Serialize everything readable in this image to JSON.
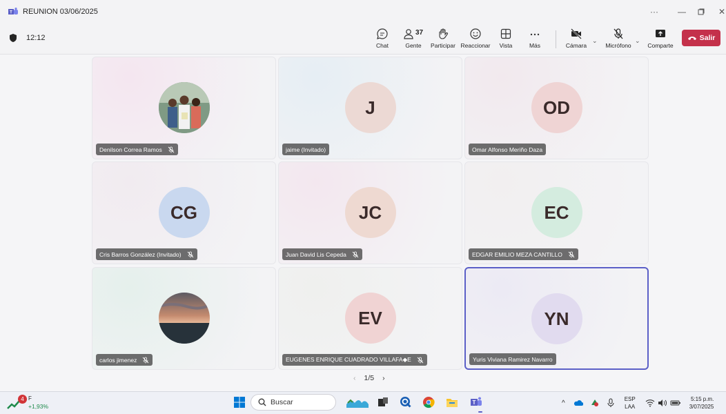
{
  "window": {
    "title": "REUNION 03/06/2025"
  },
  "meeting": {
    "elapsed": "12:12",
    "people_count": "37"
  },
  "toolbar": {
    "chat": "Chat",
    "people": "Gente",
    "raise": "Participar",
    "react": "Reaccionar",
    "view": "Vista",
    "more": "Más",
    "camera": "Cámara",
    "mic": "Micrófono",
    "share": "Comparte",
    "leave": "Salir"
  },
  "tiles": [
    {
      "name": "Denilson Correa Ramos",
      "initials": "",
      "muted": true,
      "avatar_type": "photo-people",
      "bg": "#f4e6f0"
    },
    {
      "name": "jaime (Invitado)",
      "initials": "J",
      "muted": false,
      "avatar_bg": "#ecd9d4",
      "bg": "#e6eef4"
    },
    {
      "name": "Omar Alfonso Meriño Daza",
      "initials": "OD",
      "muted": false,
      "avatar_bg": "#efd4d4",
      "bg": "#f2e9ee"
    },
    {
      "name": "Cris Barros González (Invitado)",
      "initials": "CG",
      "muted": true,
      "avatar_bg": "#c9d8ef",
      "bg": "#f1ebf0"
    },
    {
      "name": "Juan David Lis Cepeda",
      "initials": "JC",
      "muted": true,
      "avatar_bg": "#eed9d1",
      "bg": "#f3e7ef"
    },
    {
      "name": "EDGAR EMILIO MEZA CANTILLO",
      "initials": "EC",
      "muted": true,
      "avatar_bg": "#d4ecdf",
      "bg": "#f2eff0"
    },
    {
      "name": "carlos jimenez",
      "initials": "",
      "muted": true,
      "avatar_type": "photo-sunset",
      "bg": "#e5f0ec"
    },
    {
      "name": "EUGENES ENRIQUE CUADRADO VILLAFA◆E",
      "initials": "EV",
      "muted": true,
      "avatar_bg": "#f0d3d3",
      "bg": "#eff0ee"
    },
    {
      "name": "Yuris Viviana Ramirez Navarro",
      "initials": "YN",
      "muted": false,
      "avatar_bg": "#e1dbef",
      "bg": "#eceaf4"
    }
  ],
  "pager": {
    "label": "1/5"
  },
  "taskbar": {
    "weather_badge": "4",
    "weather_letter": "F",
    "weather_change": "+1,93%",
    "search_label": "Buscar",
    "lang_top": "ESP",
    "lang_bottom": "LAA",
    "time": "5:15 p.m.",
    "date": "3/07/2025"
  },
  "colors": {
    "leave": "#c4314b",
    "active_border": "#5b5fc7",
    "teams": "#5b5fc7"
  }
}
